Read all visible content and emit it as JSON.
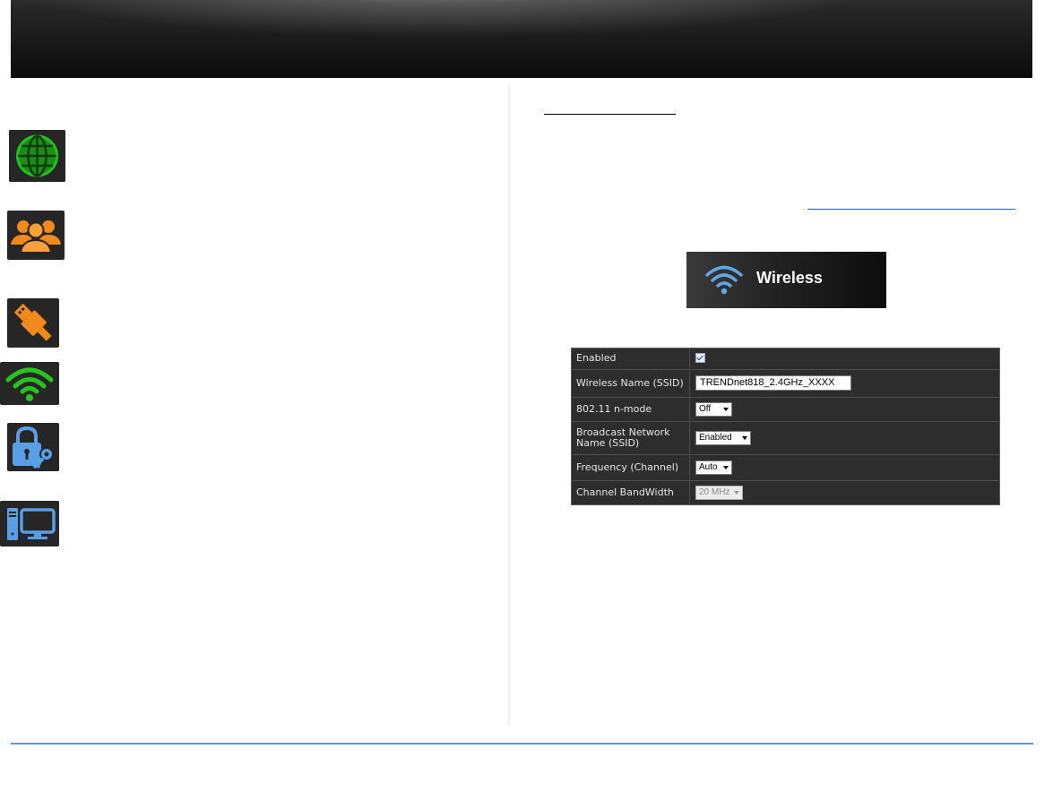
{
  "icons": [
    "globe-icon",
    "users-icon",
    "usb-icon",
    "wifi-icon",
    "lock-key-icon",
    "computer-icon"
  ],
  "wireless_banner": {
    "label": "Wireless"
  },
  "settings": {
    "rows": [
      {
        "label": "Enabled",
        "type": "checkbox",
        "checked": true
      },
      {
        "label": "Wireless Name (SSID)",
        "type": "text",
        "value": "TRENDnet818_2.4GHz_XXXX"
      },
      {
        "label": "802.11 n-mode",
        "type": "select",
        "value": "Off"
      },
      {
        "label": "Broadcast Network Name (SSID)",
        "type": "select",
        "value": "Enabled"
      },
      {
        "label": "Frequency (Channel)",
        "type": "select",
        "value": "Auto"
      },
      {
        "label": "Channel BandWidth",
        "type": "select",
        "value": "20 MHz",
        "disabled": true
      }
    ]
  },
  "colors": {
    "globe": "#22c21f",
    "users": "#f08a1c",
    "usb": "#f08a1c",
    "wifi": "#28c323",
    "lock": "#5a9ee6",
    "computer": "#5a9ee6",
    "footer_line": "#5b9bd5"
  }
}
